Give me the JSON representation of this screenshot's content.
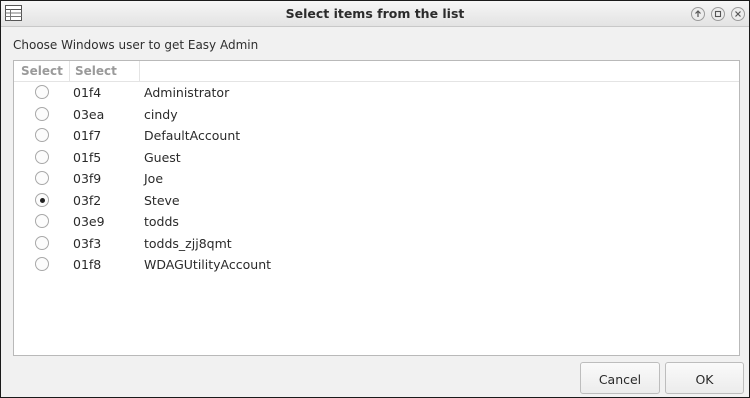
{
  "window": {
    "title": "Select items from the list",
    "prompt": "Choose Windows user to get Easy Admin"
  },
  "table": {
    "columns": [
      "Select",
      "Select"
    ],
    "rows": [
      {
        "code": "01f4",
        "name": "Administrator",
        "selected": false
      },
      {
        "code": "03ea",
        "name": "cindy",
        "selected": false
      },
      {
        "code": "01f7",
        "name": "DefaultAccount",
        "selected": false
      },
      {
        "code": "01f5",
        "name": "Guest",
        "selected": false
      },
      {
        "code": "03f9",
        "name": "Joe",
        "selected": false
      },
      {
        "code": "03f2",
        "name": "Steve",
        "selected": true
      },
      {
        "code": "03e9",
        "name": "todds",
        "selected": false
      },
      {
        "code": "03f3",
        "name": "todds_zjj8qmt",
        "selected": false
      },
      {
        "code": "01f8",
        "name": "WDAGUtilityAccount",
        "selected": false
      }
    ]
  },
  "buttons": {
    "cancel": "Cancel",
    "ok": "OK"
  },
  "icons": {
    "app": "table-icon",
    "up": "arrow-up-icon",
    "maximize": "maximize-icon",
    "close": "close-icon"
  }
}
